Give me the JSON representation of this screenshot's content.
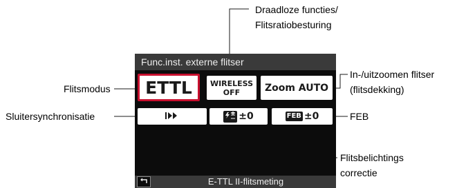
{
  "screen": {
    "title": "Func.inst. externe flitser",
    "flash_mode_value": "ETTL",
    "wireless_line1": "WIRELESS",
    "wireless_line2": "OFF",
    "zoom_value": "Zoom AUTO",
    "fec_value": "±0",
    "feb_chip": "FEB",
    "feb_value": "±0",
    "status_text": "E-TTL II-flitsmeting"
  },
  "callouts": {
    "wireless_line1": "Draadloze functies/",
    "wireless_line2": "Flitsratiobesturing",
    "zoom_line1": "In-/uitzoomen flitser",
    "zoom_line2": "(flitsdekking)",
    "flash_mode": "Flitsmodus",
    "shutter_sync": "Sluitersynchronisatie",
    "feb": "FEB",
    "fec_line1": "Flitsbelichtings",
    "fec_line2": "correctie"
  },
  "colors": {
    "selection_border": "#c8102e",
    "screen_background": "#0c0c0c",
    "title_bar": "#3a3a3a"
  },
  "icons": [
    "high-speed-sync-icon",
    "flash-exposure-compensation-icon",
    "return-arrow-icon"
  ]
}
